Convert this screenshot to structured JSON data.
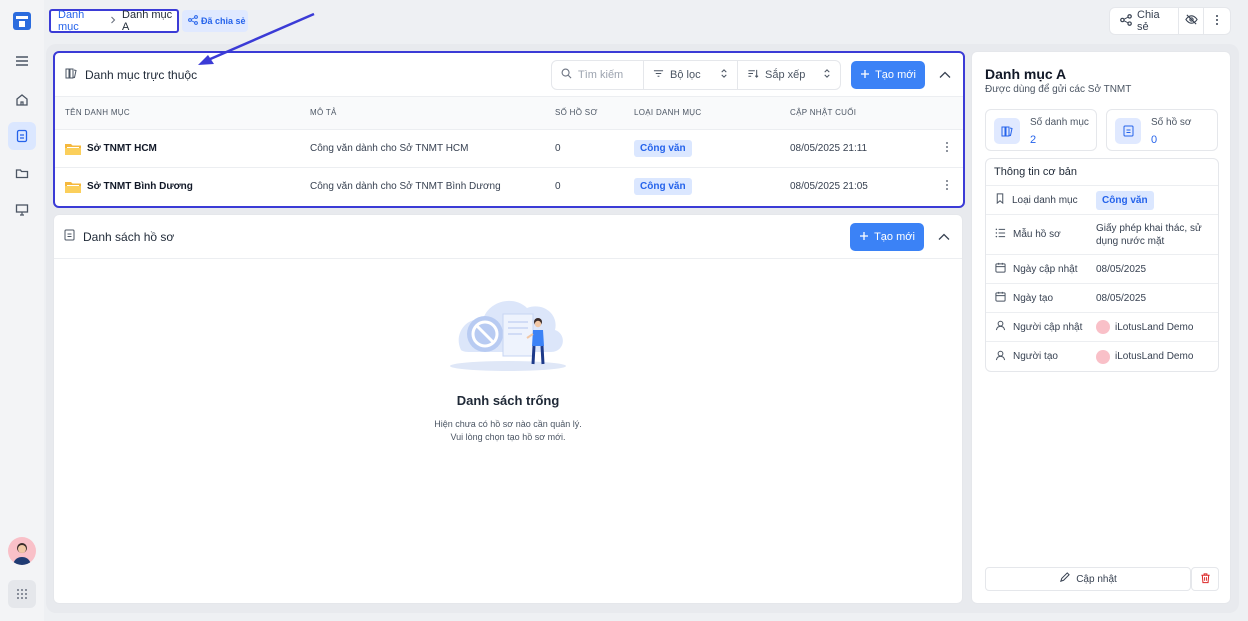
{
  "breadcrumb": {
    "root": "Danh mục",
    "current": "Danh mục A"
  },
  "shared_badge": "Đã chia sẻ",
  "top_actions": {
    "share_label": "Chia sẻ"
  },
  "rail": {
    "icons": [
      "menu-icon",
      "home-icon",
      "catalog-icon",
      "folder-icon",
      "presentation-icon"
    ],
    "active": "catalog-icon"
  },
  "subcatalog": {
    "title": "Danh mục trực thuộc",
    "search_placeholder": "Tìm kiếm",
    "filter_label": "Bộ lọc",
    "sort_label": "Sắp xếp",
    "create_label": "Tạo mới",
    "columns": [
      "TÊN DANH MỤC",
      "MÔ TẢ",
      "SỐ HỒ SƠ",
      "LOẠI DANH MỤC",
      "CẬP NHẬT CUỐI"
    ],
    "rows": [
      {
        "name": "Sở TNMT HCM",
        "description": "Công văn dành cho Sở TNMT HCM",
        "count": "0",
        "type": "Công văn",
        "updated": "08/05/2025 21:11"
      },
      {
        "name": "Sở TNMT Bình Dương",
        "description": "Công văn dành cho Sở TNMT Bình Dương",
        "count": "0",
        "type": "Công văn",
        "updated": "08/05/2025 21:05"
      }
    ]
  },
  "files": {
    "title": "Danh sách hồ sơ",
    "create_label": "Tạo mới",
    "empty_title": "Danh sách trống",
    "empty_line1": "Hiện chưa có hồ sơ nào cần quản lý.",
    "empty_line2": "Vui lòng chọn tạo hồ sơ mới."
  },
  "side": {
    "title": "Danh mục A",
    "subtitle": "Được dùng để gửi các Sở TNMT",
    "stat_catalogs_label": "Số danh mục",
    "stat_catalogs_value": "2",
    "stat_files_label": "Số hồ sơ",
    "stat_files_value": "0",
    "info_title": "Thông tin cơ bản",
    "type_label": "Loại danh mục",
    "type_value": "Công văn",
    "template_label": "Mẫu hồ sơ",
    "template_value": "Giấy phép khai thác, sử dụng nước mặt",
    "updated_label": "Ngày cập nhật",
    "updated_value": "08/05/2025",
    "created_label": "Ngày tạo",
    "created_value": "08/05/2025",
    "updater_label": "Người cập nhật",
    "updater_value": "iLotusLand Demo",
    "creator_label": "Người tạo",
    "creator_value": "iLotusLand Demo",
    "update_button": "Cập nhật"
  },
  "colors": {
    "accent": "#3b82f6",
    "highlight_border": "#3b3bd6",
    "tag_bg": "#dbe7ff"
  }
}
